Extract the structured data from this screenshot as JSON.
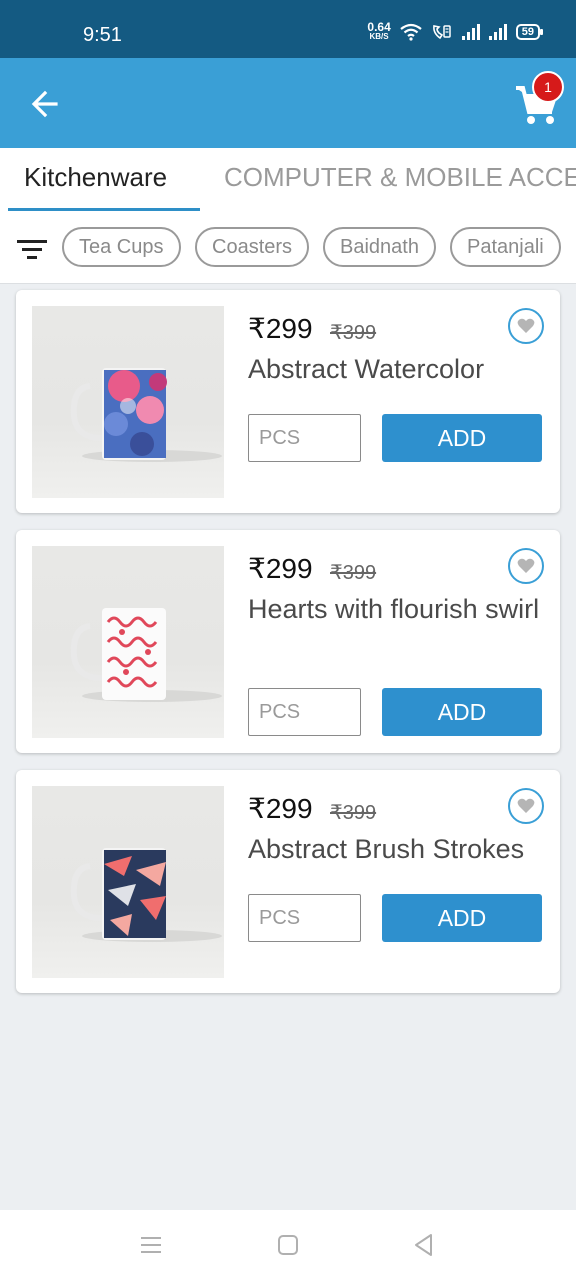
{
  "status_bar": {
    "time": "9:51",
    "net_speed_value": "0.64",
    "net_speed_unit": "KB/S",
    "battery": "59"
  },
  "app_bar": {
    "back_icon": "arrow-left-icon",
    "cart_icon": "cart-icon",
    "cart_count": "1",
    "color": "#3a9fd6"
  },
  "tabs": [
    {
      "label": "Kitchenware",
      "active": true
    },
    {
      "label": "COMPUTER & MOBILE ACCE",
      "active": false
    }
  ],
  "filters": {
    "icon": "filter-icon",
    "chips": [
      "Tea Cups",
      "Coasters",
      "Baidnath",
      "Patanjali"
    ]
  },
  "products": [
    {
      "price": "₹299",
      "mrp": "₹399",
      "title": "Abstract Watercolor",
      "qty_placeholder": "PCS",
      "add_label": "ADD"
    },
    {
      "price": "₹299",
      "mrp": "₹399",
      "title": "Hearts with flourish swirl",
      "qty_placeholder": "PCS",
      "add_label": "ADD"
    },
    {
      "price": "₹299",
      "mrp": "₹399",
      "title": "Abstract Brush Strokes",
      "qty_placeholder": "PCS",
      "add_label": "ADD"
    }
  ],
  "accent_color": "#2e90ce",
  "nav_bar": [
    "menu-icon",
    "home-square-icon",
    "back-triangle-icon"
  ]
}
